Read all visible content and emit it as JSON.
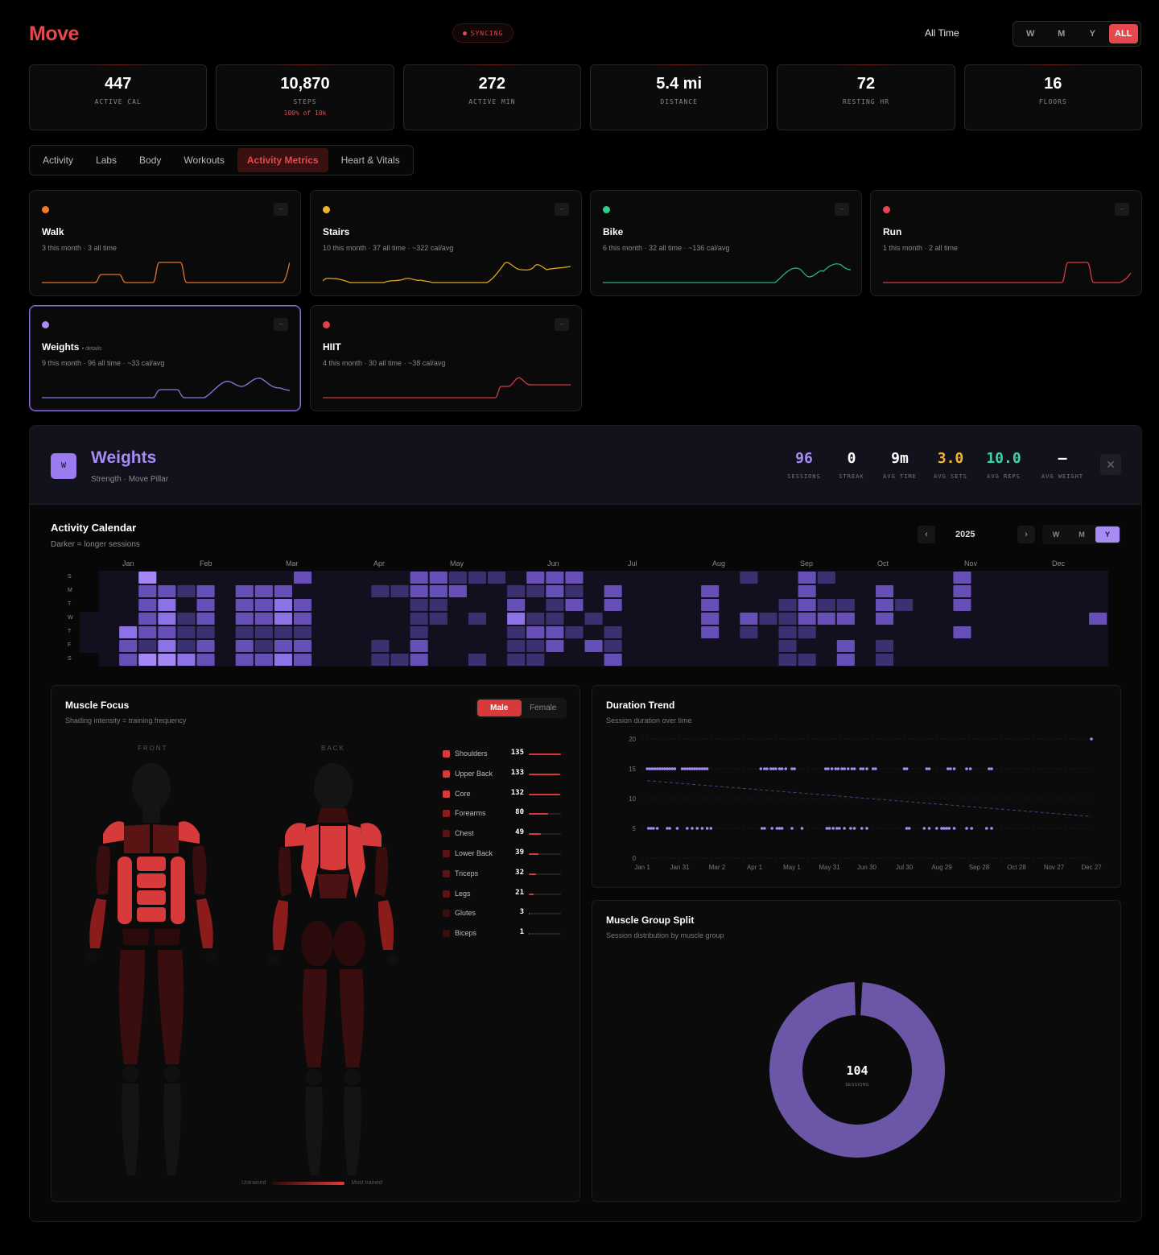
{
  "header": {
    "brand": "Move",
    "sync_status": "SYNCING",
    "range_label": "All Time",
    "period_options": [
      "W",
      "M",
      "Y",
      "ALL"
    ],
    "period_active": "ALL"
  },
  "stats": [
    {
      "value": "447",
      "label": "ACTIVE CAL",
      "sub": ""
    },
    {
      "value": "10,870",
      "label": "STEPS",
      "sub": "100% of 10k"
    },
    {
      "value": "272",
      "label": "ACTIVE MIN",
      "sub": ""
    },
    {
      "value": "5.4 mi",
      "label": "DISTANCE",
      "sub": ""
    },
    {
      "value": "72",
      "label": "RESTING HR",
      "sub": ""
    },
    {
      "value": "16",
      "label": "FLOORS",
      "sub": ""
    }
  ],
  "tabs": [
    "Activity",
    "Labs",
    "Body",
    "Workouts",
    "Activity Metrics",
    "Heart & Vitals"
  ],
  "tab_active": "Activity Metrics",
  "activity_cards": [
    {
      "name": "Walk",
      "details": "",
      "sub": "3 this month · 3 all time",
      "color": "#f07a2a",
      "selected": false
    },
    {
      "name": "Stairs",
      "details": "",
      "sub": "10 this month · 37 all time · ~322 cal/avg",
      "color": "#f2b42c",
      "selected": false
    },
    {
      "name": "Bike",
      "details": "",
      "sub": "6 this month · 32 all time · ~136 cal/avg",
      "color": "#2fcf8a",
      "selected": false
    },
    {
      "name": "Run",
      "details": "",
      "sub": "1 this month · 2 all time",
      "color": "#e5484d",
      "selected": false
    },
    {
      "name": "Weights",
      "details": "• details",
      "sub": "9 this month · 96 all time · ~33 cal/avg",
      "color": "#a88bf5",
      "selected": true
    },
    {
      "name": "HIIT",
      "details": "",
      "sub": "4 this month · 30 all time · ~38 cal/avg",
      "color": "#e5404a",
      "selected": false
    }
  ],
  "detail": {
    "badge": "W",
    "title": "Weights",
    "subtitle": "Strength · Move Pillar",
    "kpis": [
      {
        "value": "96",
        "label": "SESSIONS",
        "color": "#a88bf5"
      },
      {
        "value": "0",
        "label": "STREAK",
        "color": "#ffffff"
      },
      {
        "value": "9m",
        "label": "AVG TIME",
        "color": "#ffffff"
      },
      {
        "value": "3.0",
        "label": "AVG SETS",
        "color": "#f2b42c"
      },
      {
        "value": "10.0",
        "label": "AVG REPS",
        "color": "#3ad6a6"
      },
      {
        "value": "–",
        "label": "AVG WEIGHT",
        "color": "#ffffff"
      }
    ],
    "close_icon": "close-icon"
  },
  "calendar": {
    "title": "Activity Calendar",
    "subtitle": "Darker = longer sessions",
    "year": "2025",
    "view_options": [
      "W",
      "M",
      "Y"
    ],
    "view_active": "Y",
    "months": [
      "Jan",
      "Feb",
      "Mar",
      "Apr",
      "May",
      "Jun",
      "Jul",
      "Aug",
      "Sep",
      "Oct",
      "Nov",
      "Dec"
    ],
    "day_labels": [
      "S",
      "M",
      "T",
      "W",
      "T",
      "F",
      "S"
    ],
    "active_days": {
      "0": [
        [
          1,
          0,
          2
        ],
        [
          2,
          3,
          4
        ],
        [
          2,
          5,
          6
        ],
        [
          2,
          6,
          1
        ]
      ],
      "1": [
        [
          1,
          2,
          3
        ],
        [
          1,
          4,
          2
        ],
        [
          2,
          7,
          1
        ]
      ]
    }
  },
  "muscle_focus": {
    "title": "Muscle Focus",
    "subtitle": "Shading intensity = training frequency",
    "sex_options": [
      "Male",
      "Female"
    ],
    "sex_active": "Male",
    "front_label": "FRONT",
    "back_label": "BACK",
    "muscles": [
      {
        "name": "Shoulders",
        "count": 135
      },
      {
        "name": "Upper Back",
        "count": 133
      },
      {
        "name": "Core",
        "count": 132
      },
      {
        "name": "Forearms",
        "count": 80
      },
      {
        "name": "Chest",
        "count": 49
      },
      {
        "name": "Lower Back",
        "count": 39
      },
      {
        "name": "Triceps",
        "count": 32
      },
      {
        "name": "Legs",
        "count": 21
      },
      {
        "name": "Glutes",
        "count": 3
      },
      {
        "name": "Biceps",
        "count": 1
      }
    ],
    "legend_min": "Untrained",
    "legend_max": "Most trained"
  },
  "duration_trend": {
    "title": "Duration Trend",
    "subtitle": "Session duration over time"
  },
  "chart_data": [
    {
      "type": "scatter",
      "title": "Duration Trend",
      "subtitle": "Session duration over time",
      "x_tick_labels": [
        "Jan 1",
        "Jan 31",
        "Mar 2",
        "Apr 1",
        "May 1",
        "May 31",
        "Jun 30",
        "Jul 30",
        "Aug 29",
        "Sep 28",
        "Oct 28",
        "Nov 27",
        "Dec 27"
      ],
      "y_ticks": [
        0,
        5,
        10,
        15,
        20
      ],
      "ylim": [
        0,
        20
      ],
      "series": [
        {
          "values_x_day": [
            4,
            6,
            8,
            10,
            12,
            14,
            16,
            18,
            20,
            22,
            24,
            26,
            32,
            34,
            36,
            38,
            40,
            42,
            44,
            46,
            48,
            50,
            52,
            95,
            98,
            100,
            103,
            105,
            107,
            110,
            112,
            115,
            120,
            122,
            147,
            149,
            152,
            155,
            157,
            160,
            162,
            165,
            168,
            170,
            175,
            177,
            180,
            185,
            187,
            210,
            212,
            228,
            230,
            245,
            247,
            250,
            260,
            263,
            278,
            280
          ],
          "y": 15
        },
        {
          "values_x_day": [
            5,
            7,
            9,
            12,
            20,
            22,
            28,
            36,
            40,
            44,
            48,
            52,
            55,
            96,
            98,
            104,
            108,
            110,
            112,
            120,
            128,
            148,
            150,
            153,
            156,
            158,
            162,
            167,
            170,
            176,
            180,
            212,
            214,
            226,
            230,
            236,
            240,
            242,
            244,
            246,
            250,
            260,
            264,
            276,
            280
          ],
          "y": 5
        },
        {
          "values_x_day": [
            360
          ],
          "y": 20
        }
      ],
      "trend": {
        "from": [
          4,
          13
        ],
        "to": [
          360,
          7
        ]
      },
      "grid": true,
      "color": "#a88bf5"
    },
    {
      "type": "pie",
      "title": "Muscle Group Split",
      "subtitle": "Session distribution by muscle group",
      "center_value": "104",
      "center_label": "SESSIONS",
      "slices": [
        {
          "value": 100,
          "color": "#6b56a8"
        }
      ]
    }
  ],
  "muscle_split": {
    "title": "Muscle Group Split",
    "subtitle": "Session distribution by muscle group",
    "center_value": "104",
    "center_label": "SESSIONS"
  }
}
